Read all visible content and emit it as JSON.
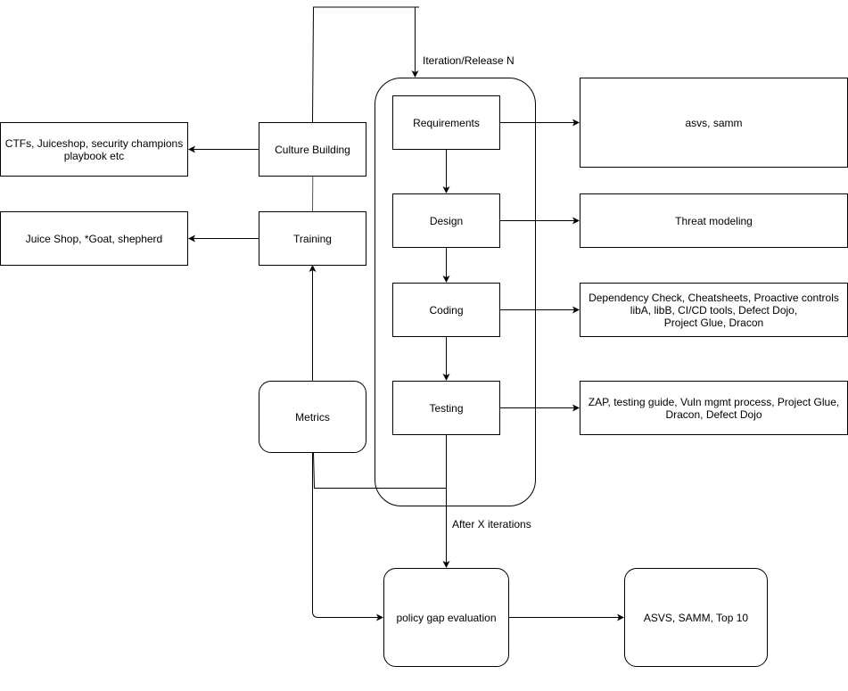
{
  "diagram": {
    "labels": {
      "iteration": "Iteration/Release N",
      "after_iterations": "After X iterations"
    },
    "nodes": {
      "requirements": "Requirements",
      "design": "Design",
      "coding": "Coding",
      "testing": "Testing",
      "culture_building": "Culture Building",
      "training": "Training",
      "metrics": "Metrics",
      "policy_gap": "policy gap evaluation",
      "asvs_samm_top10": "ASVS, SAMM, Top 10",
      "culture_tools": "CTFs, Juiceshop, security champions\nplaybook etc",
      "training_tools": "Juice Shop, *Goat, shepherd",
      "requirements_tools": "asvs, samm",
      "design_tools": "Threat modeling",
      "coding_tools": "Dependency Check, Cheatsheets, Proactive controls\nlibA, libB, CI/CD tools, Defect Dojo,\nProject Glue, Dracon",
      "testing_tools": "ZAP, testing guide, Vuln mgmt process, Project Glue,\nDracon, Defect Dojo"
    }
  }
}
